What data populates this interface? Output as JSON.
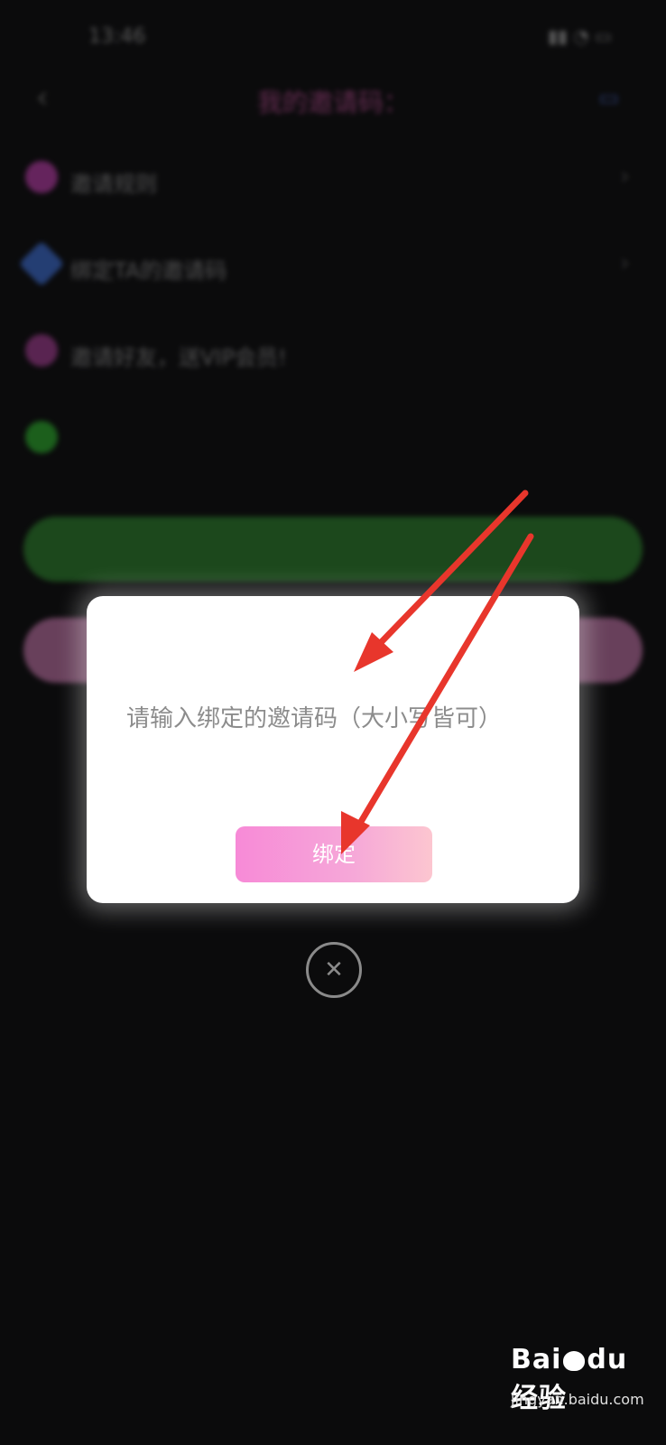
{
  "status_bar": {
    "time": "13:46",
    "indicators": "5G 4G wifi battery"
  },
  "header": {
    "title": "我的邀请码："
  },
  "menu": [
    {
      "label": "邀请规则",
      "icon": "diamond-icon",
      "color": "#b03aa0"
    },
    {
      "label": "绑定TA的邀请码",
      "icon": "pen-icon",
      "color": "#3a68c8"
    },
    {
      "label": "邀请好友，送VIP会员!",
      "icon": "gift-icon",
      "color": "#9a3a8a"
    },
    {
      "label": "",
      "icon": "wechat-icon",
      "color": "#2aa42a"
    }
  ],
  "buttons": {
    "green_label": ""
  },
  "dialog": {
    "title": "",
    "input_placeholder": "请输入绑定的邀请码（大小写皆可）",
    "input_value": "",
    "bind_label": "绑定"
  },
  "close_glyph": "✕",
  "watermark": {
    "logo_text": "Bai",
    "logo_text_2": "du",
    "product": "经验",
    "url": "jingyan.baidu.com"
  },
  "colors": {
    "arrow": "#e8362c",
    "bind_start": "#f78ad7",
    "bind_end": "#fcc6d0"
  }
}
